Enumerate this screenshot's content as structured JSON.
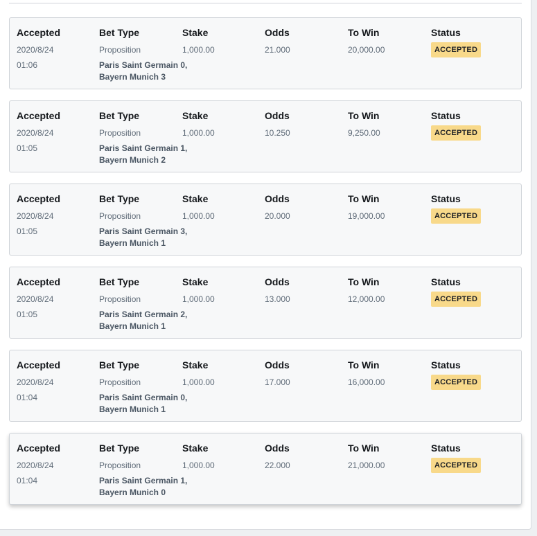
{
  "headers": {
    "accepted": "Accepted",
    "bet_type": "Bet Type",
    "stake": "Stake",
    "odds": "Odds",
    "to_win": "To Win",
    "status": "Status"
  },
  "colors": {
    "badge_bg": "#f8d98a",
    "card_bg": "#f7f8f9",
    "muted_text": "#5f6b78"
  },
  "bets": [
    {
      "date": "2020/8/24",
      "time": "01:06",
      "bet_type": "Proposition",
      "selection": "Paris Saint Germain 0,\nBayern Munich 3",
      "stake": "1,000.00",
      "odds": "21.000",
      "to_win": "20,000.00",
      "status": "ACCEPTED"
    },
    {
      "date": "2020/8/24",
      "time": "01:05",
      "bet_type": "Proposition",
      "selection": "Paris Saint Germain 1,\nBayern Munich 2",
      "stake": "1,000.00",
      "odds": "10.250",
      "to_win": "9,250.00",
      "status": "ACCEPTED"
    },
    {
      "date": "2020/8/24",
      "time": "01:05",
      "bet_type": "Proposition",
      "selection": "Paris Saint Germain 3,\nBayern Munich 1",
      "stake": "1,000.00",
      "odds": "20.000",
      "to_win": "19,000.00",
      "status": "ACCEPTED"
    },
    {
      "date": "2020/8/24",
      "time": "01:05",
      "bet_type": "Proposition",
      "selection": "Paris Saint Germain 2,\nBayern Munich 1",
      "stake": "1,000.00",
      "odds": "13.000",
      "to_win": "12,000.00",
      "status": "ACCEPTED"
    },
    {
      "date": "2020/8/24",
      "time": "01:04",
      "bet_type": "Proposition",
      "selection": "Paris Saint Germain 0,\nBayern Munich 1",
      "stake": "1,000.00",
      "odds": "17.000",
      "to_win": "16,000.00",
      "status": "ACCEPTED"
    },
    {
      "date": "2020/8/24",
      "time": "01:04",
      "bet_type": "Proposition",
      "selection": "Paris Saint Germain 1,\nBayern Munich 0",
      "stake": "1,000.00",
      "odds": "22.000",
      "to_win": "21,000.00",
      "status": "ACCEPTED"
    }
  ]
}
